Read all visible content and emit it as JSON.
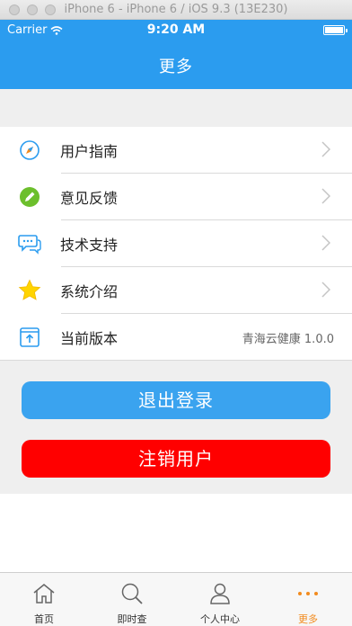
{
  "window": {
    "title": "iPhone 6 - iPhone 6 / iOS 9.3 (13E230)"
  },
  "statusbar": {
    "carrier": "Carrier",
    "time": "9:20 AM"
  },
  "header": {
    "title": "更多"
  },
  "menu": {
    "items": [
      {
        "label": "用户指南",
        "icon": "compass-icon",
        "color": "#2b9cef"
      },
      {
        "label": "意见反馈",
        "icon": "pencil-icon",
        "color": "#6cbf2c"
      },
      {
        "label": "技术支持",
        "icon": "chat-bubbles-icon",
        "color": "#2b9cef"
      },
      {
        "label": "系统介绍",
        "icon": "star-icon",
        "color": "#ffd400"
      },
      {
        "label": "当前版本",
        "icon": "upload-box-icon",
        "color": "#2b9cef",
        "value": "青海云健康 1.0.0"
      }
    ]
  },
  "buttons": {
    "logout": "退出登录",
    "cancel_account": "注销用户"
  },
  "tabbar": {
    "tabs": [
      {
        "label": "首页",
        "icon": "home-icon"
      },
      {
        "label": "即时查",
        "icon": "search-icon"
      },
      {
        "label": "个人中心",
        "icon": "person-icon"
      },
      {
        "label": "更多",
        "icon": "more-dots-icon",
        "active": true
      }
    ]
  },
  "colors": {
    "accent": "#2b9cef",
    "danger": "#ff0000",
    "active_tab": "#f28b1e"
  }
}
